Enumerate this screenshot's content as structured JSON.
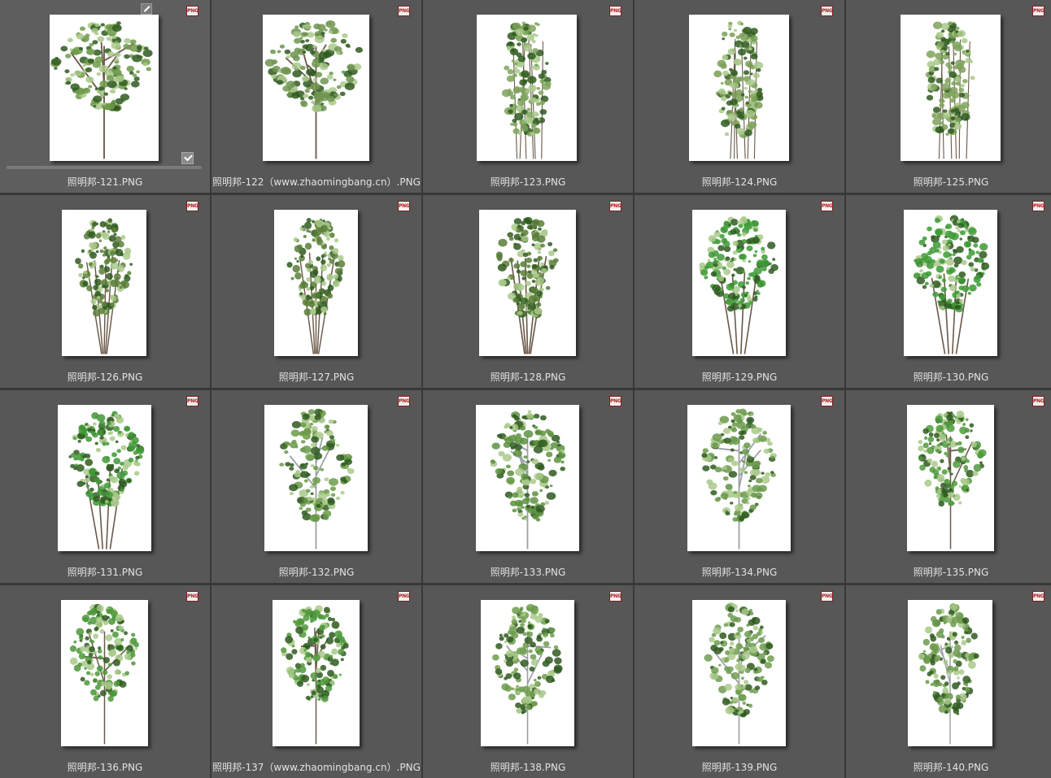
{
  "items": [
    {
      "label": "照明邦-121.PNG",
      "badge": "PNG",
      "selected": true,
      "tree": "broad",
      "color": "#6e9a4a"
    },
    {
      "label": "照明邦-122（www.zhaomingbang.cn）.PNG",
      "badge": "PNG",
      "tree": "broad",
      "color": "#6f9450"
    },
    {
      "label": "照明邦-123.PNG",
      "badge": "PNG",
      "tree": "bamboo",
      "color": "#7ea35a"
    },
    {
      "label": "照明邦-124.PNG",
      "badge": "PNG",
      "tree": "bamboo",
      "color": "#7a9d55"
    },
    {
      "label": "照明邦-125.PNG",
      "badge": "PNG",
      "tree": "bamboo",
      "color": "#7fa25c"
    },
    {
      "label": "照明邦-126.PNG",
      "badge": "PNG",
      "tree": "vase",
      "color": "#5c7f3a"
    },
    {
      "label": "照明邦-127.PNG",
      "badge": "PNG",
      "tree": "vase",
      "color": "#5a7e38"
    },
    {
      "label": "照明邦-128.PNG",
      "badge": "PNG",
      "tree": "vase",
      "color": "#587c36"
    },
    {
      "label": "照明邦-129.PNG",
      "badge": "PNG",
      "tree": "round",
      "color": "#3e9a36"
    },
    {
      "label": "照明邦-130.PNG",
      "badge": "PNG",
      "tree": "round",
      "color": "#3c9a34"
    },
    {
      "label": "照明邦-131.PNG",
      "badge": "PNG",
      "tree": "round",
      "color": "#3f9636"
    },
    {
      "label": "照明邦-132.PNG",
      "badge": "PNG",
      "tree": "birch",
      "color": "#6a9a48"
    },
    {
      "label": "照明邦-133.PNG",
      "badge": "PNG",
      "tree": "birch",
      "color": "#5e9240"
    },
    {
      "label": "照明邦-134.PNG",
      "badge": "PNG",
      "tree": "birch",
      "color": "#68994a"
    },
    {
      "label": "照明邦-135.PNG",
      "badge": "PNG",
      "tree": "spread",
      "color": "#4f9a3c"
    },
    {
      "label": "照明邦-136.PNG",
      "badge": "PNG",
      "tree": "spread",
      "color": "#4c983a"
    },
    {
      "label": "照明邦-137（www.zhaomingbang.cn）.PNG",
      "badge": "PNG",
      "tree": "spread",
      "color": "#4f9a3c"
    },
    {
      "label": "照明邦-138.PNG",
      "badge": "PNG",
      "tree": "birch",
      "color": "#6d9c4c"
    },
    {
      "label": "照明邦-139.PNG",
      "badge": "PNG",
      "tree": "birch",
      "color": "#6f9c50"
    },
    {
      "label": "照明邦-140.PNG",
      "badge": "PNG",
      "tree": "birch",
      "color": "#6c9a4c"
    }
  ]
}
